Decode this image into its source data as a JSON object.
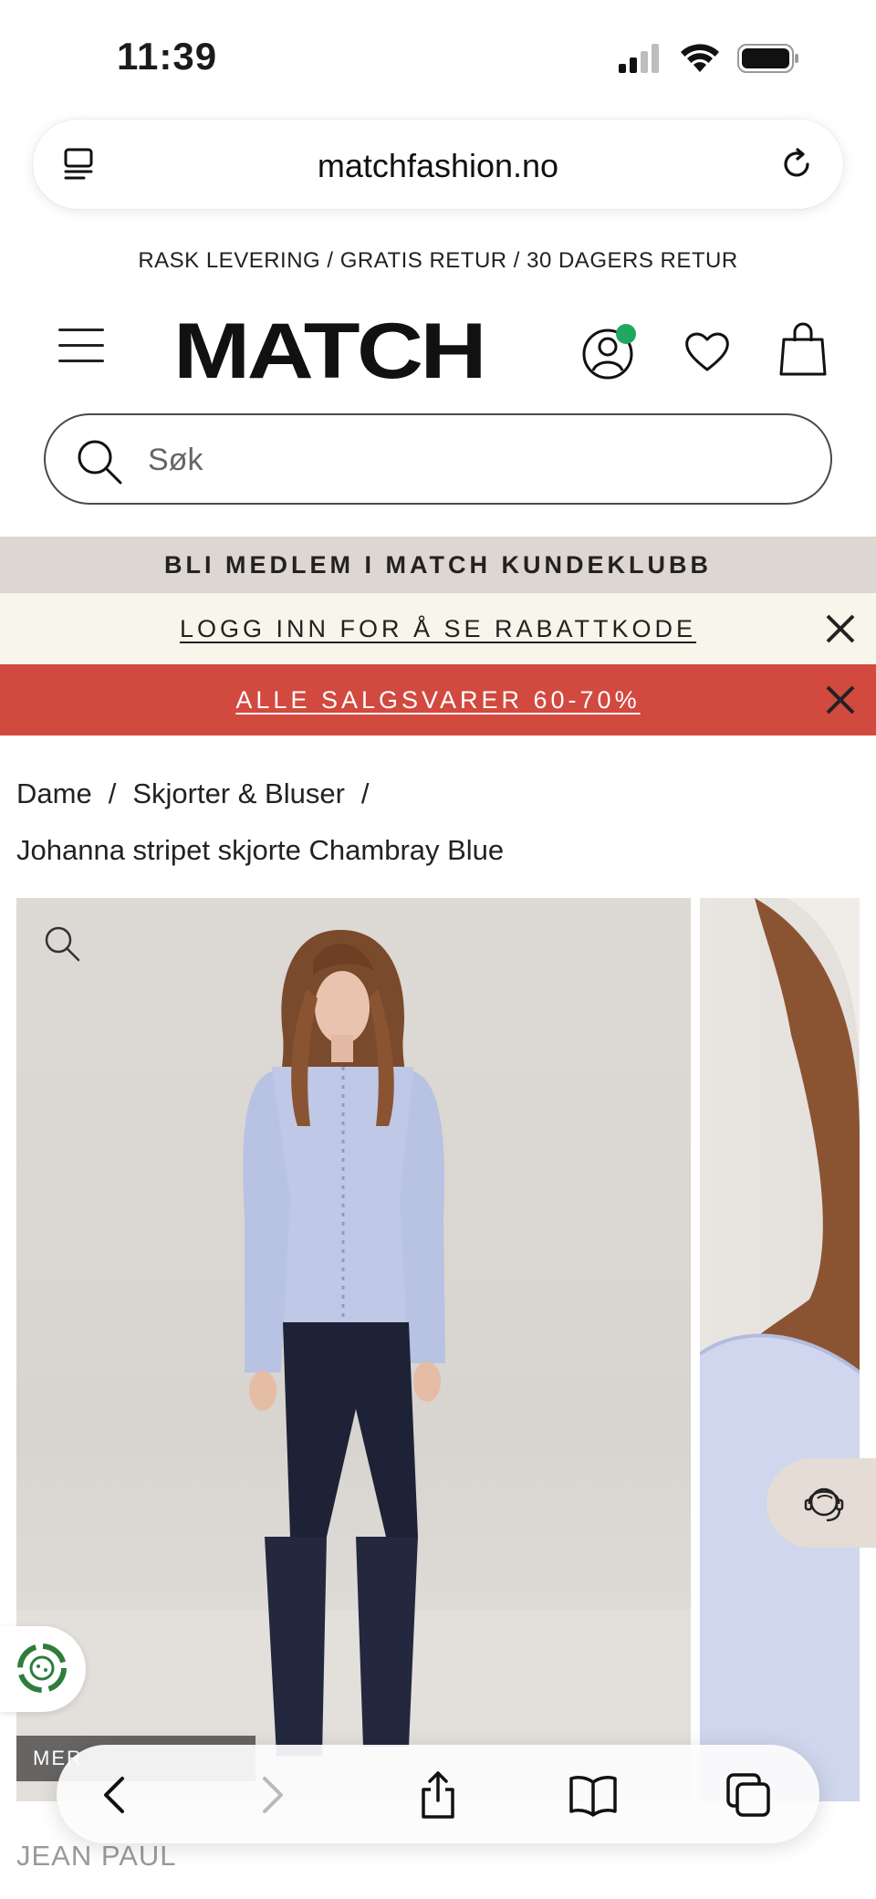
{
  "status_bar": {
    "time": "11:39",
    "icons": [
      "cellular-signal-icon",
      "wifi-icon",
      "battery-icon"
    ]
  },
  "browser": {
    "url": "matchfashion.no",
    "left_icon": "tab-overview-icon",
    "right_icon": "reload-icon"
  },
  "promo": {
    "text": "RASK LEVERING / GRATIS RETUR / 30 DAGERS RETUR"
  },
  "header": {
    "logo_text": "MATCH",
    "icons": [
      "menu-icon",
      "account-icon",
      "heart-icon",
      "shopping-bag-icon"
    ],
    "notification_dot_color": "#1fa85e"
  },
  "search": {
    "placeholder": "Søk"
  },
  "banners": {
    "member": "BLI MEDLEM I MATCH KUNDEKLUBB",
    "login": "LOGG INN FOR Å SE RABATTKODE",
    "sale": "ALLE SALGSVARER 60-70%",
    "sale_color": "#d2493f",
    "login_bg": "#f8f5ea",
    "member_bg": "#ddd6d1"
  },
  "breadcrumb": {
    "items": [
      "Dame",
      "Skjorter & Bluser"
    ],
    "separator": "/"
  },
  "product": {
    "title": "Johanna stripet skjorte Chambray Blue",
    "brand": "JEAN PAUL",
    "tag_label": "MER"
  },
  "toolbar": {
    "icons": [
      "back-icon",
      "forward-icon",
      "share-icon",
      "bookmarks-icon",
      "tabs-icon"
    ]
  }
}
